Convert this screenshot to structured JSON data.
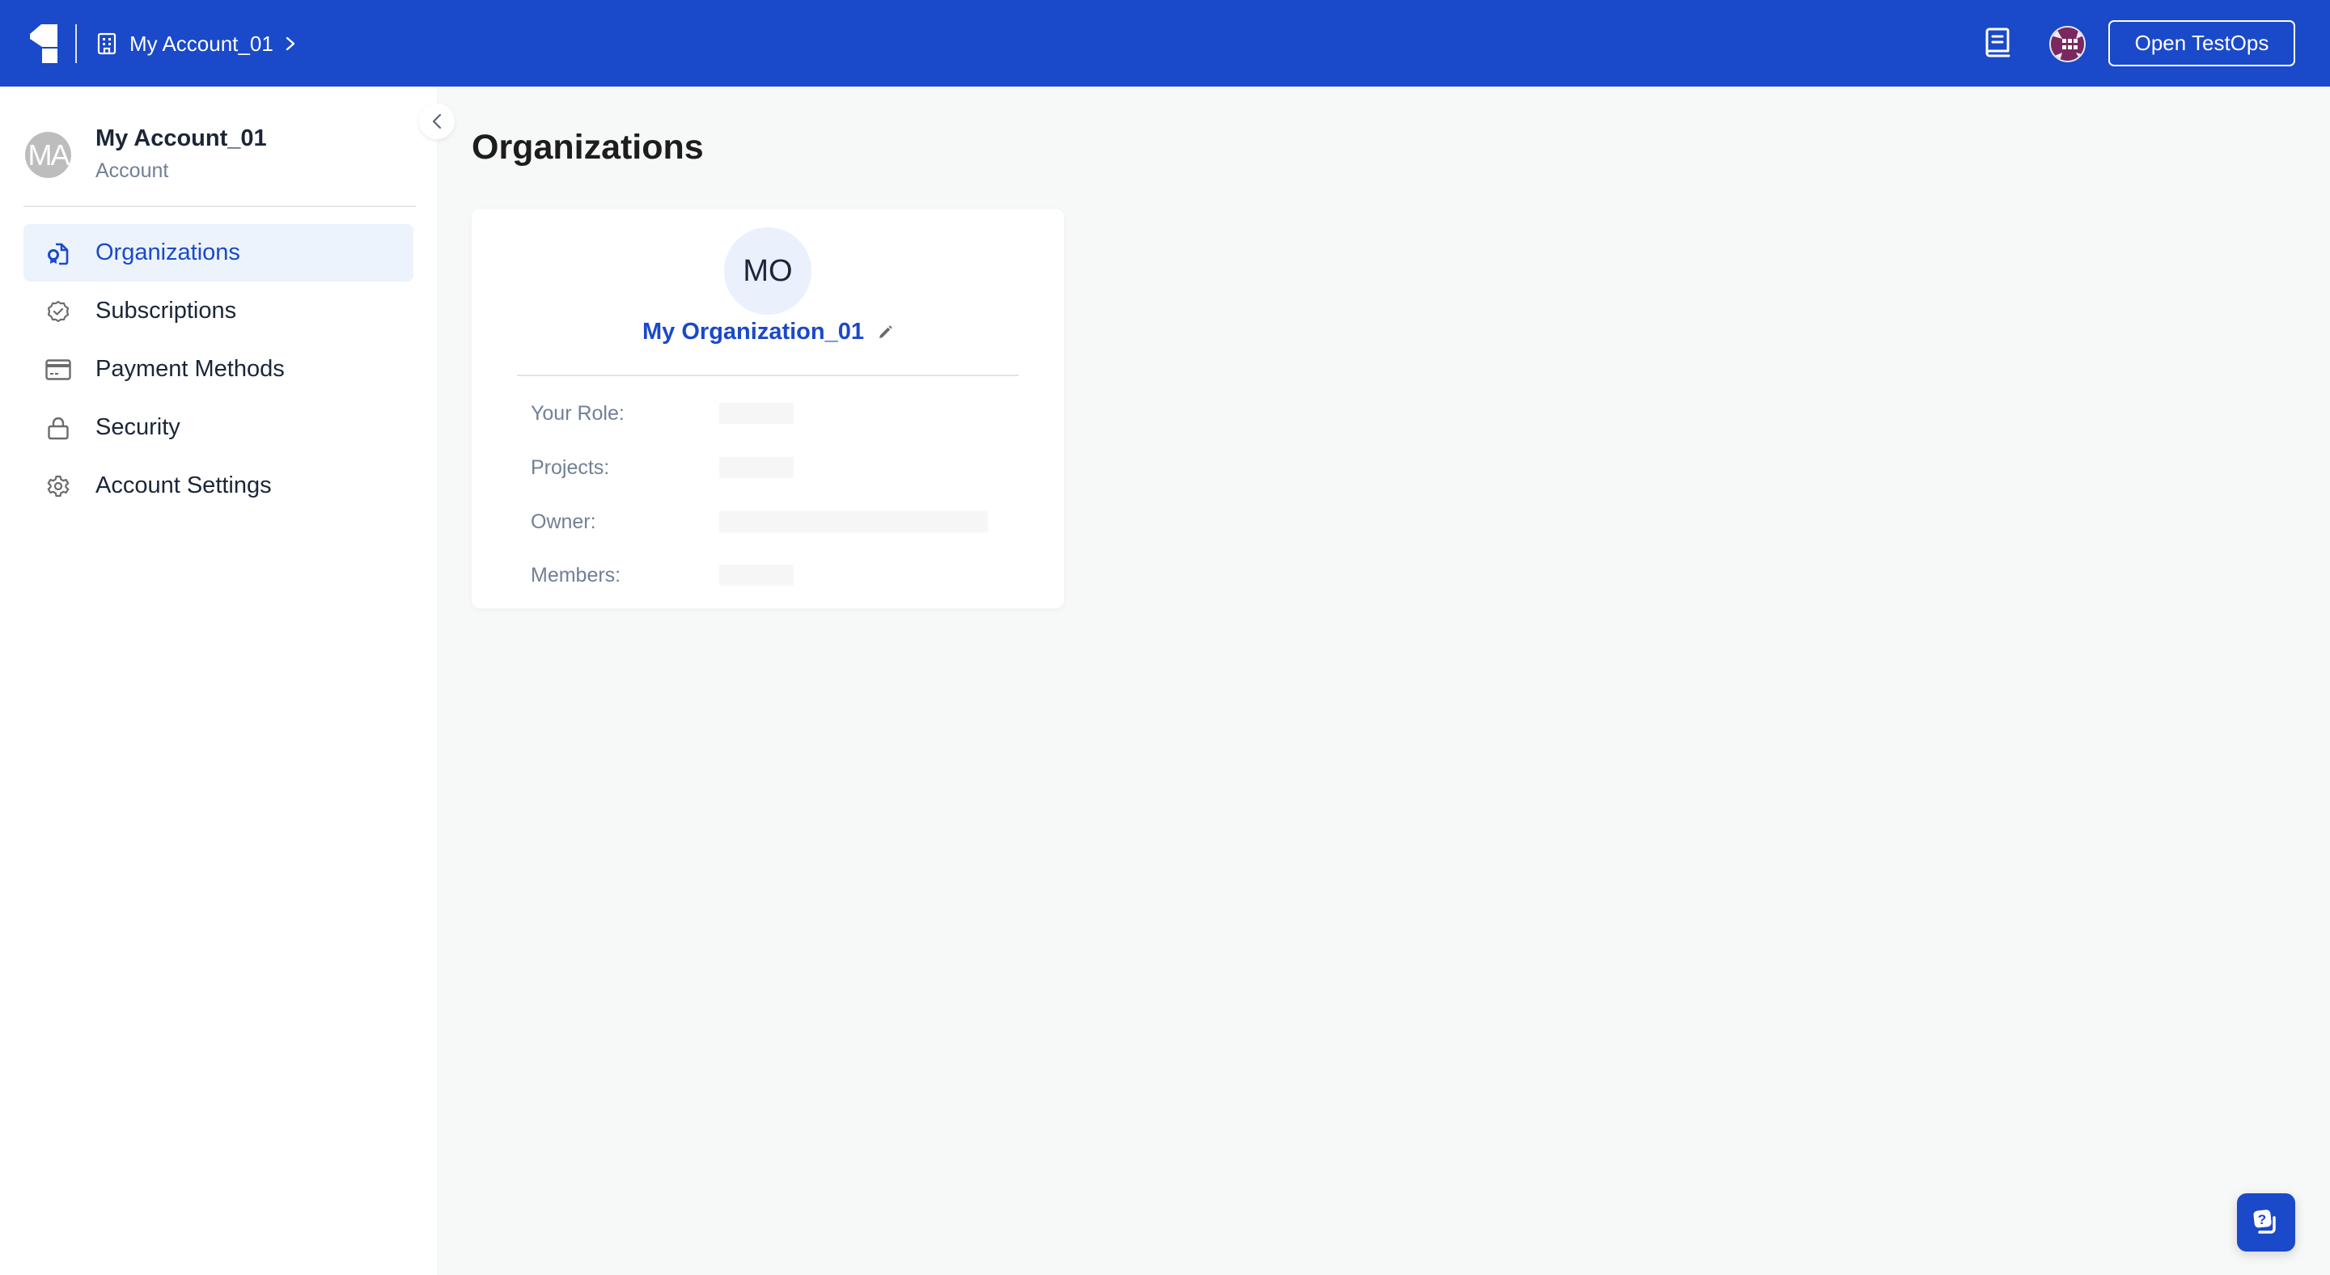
{
  "header": {
    "logo": "katalon-logo",
    "breadcrumb_icon": "building-icon",
    "breadcrumb_label": "My Account_01",
    "breadcrumb_chevron": "chevron-right-icon",
    "docs_icon": "book-icon",
    "user_avatar": "globe-avatar",
    "open_button_label": "Open TestOps",
    "brand_color": "#1a49c9"
  },
  "sidebar": {
    "avatar_initials": "MA",
    "account_name": "My Account_01",
    "account_type": "Account",
    "collapse_icon": "chevron-left-icon",
    "items": [
      {
        "label": "Organizations",
        "icon": "organization-certificate-icon",
        "active": true
      },
      {
        "label": "Subscriptions",
        "icon": "badge-check-icon",
        "active": false
      },
      {
        "label": "Payment Methods",
        "icon": "credit-card-icon",
        "active": false
      },
      {
        "label": "Security",
        "icon": "lock-icon",
        "active": false
      },
      {
        "label": "Account Settings",
        "icon": "gear-icon",
        "active": false
      }
    ]
  },
  "main": {
    "title": "Organizations",
    "organizations": [
      {
        "initials": "MO",
        "name": "My Organization_01",
        "edit_icon": "pencil-icon",
        "details": [
          {
            "label": "Your Role:",
            "value": ""
          },
          {
            "label": "Projects:",
            "value": ""
          },
          {
            "label": "Owner:",
            "value": ""
          },
          {
            "label": "Members:",
            "value": ""
          }
        ]
      }
    ]
  },
  "help": {
    "icon": "help-chat-icon"
  }
}
